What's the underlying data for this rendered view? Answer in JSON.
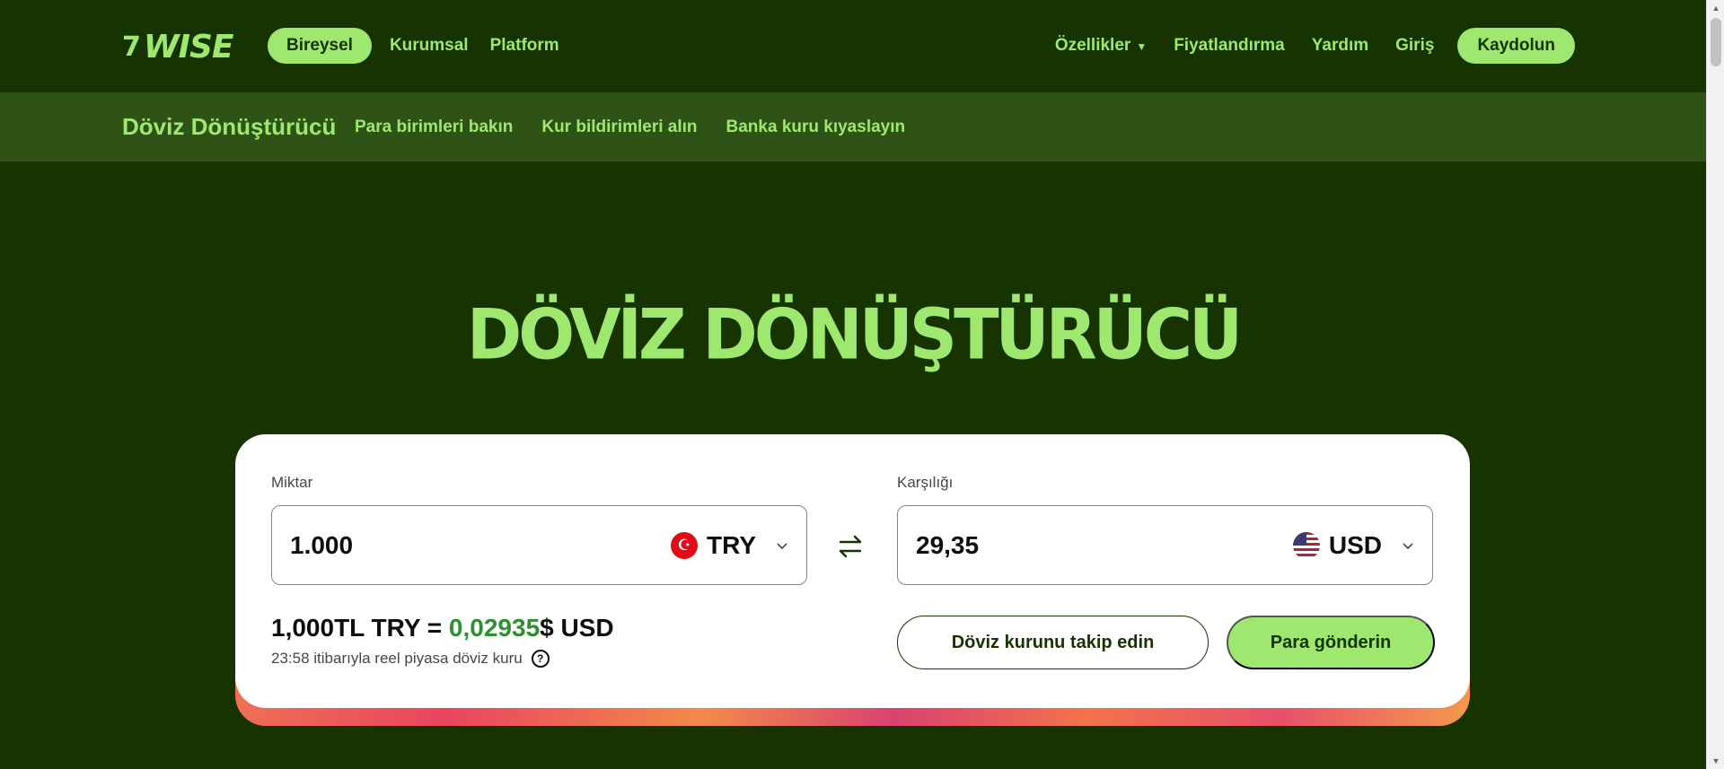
{
  "brand": {
    "logo_text": "WISE",
    "logo_mark": "7"
  },
  "topnav": {
    "left": [
      "Bireysel",
      "Kurumsal",
      "Platform"
    ],
    "right": [
      "Özellikler",
      "Fiyatlandırma",
      "Yardım",
      "Giriş"
    ],
    "signup": "Kaydolun"
  },
  "subnav": {
    "title": "Döviz Dönüştürücü",
    "links": [
      "Para birimleri bakın",
      "Kur bildirimleri alın",
      "Banka kuru kıyaslayın"
    ]
  },
  "hero": {
    "title": "DÖVİZ DÖNÜŞTÜRÜCÜ"
  },
  "converter": {
    "from": {
      "label": "Miktar",
      "value": "1.000",
      "currency": "TRY",
      "flag": "turkey-flag-icon"
    },
    "to": {
      "label": "Karşılığı",
      "value": "29,35",
      "currency": "USD",
      "flag": "usa-flag-icon"
    },
    "rate": {
      "prefix": "1,000TL TRY = ",
      "value": "0,02935",
      "suffix": "$ USD"
    },
    "rate_note": "23:58 itibarıyla reel piyasa döviz kuru",
    "track_button": "Döviz kurunu takip edin",
    "send_button": "Para gönderin"
  },
  "colors": {
    "background": "#163300",
    "accent": "#9fe870",
    "subnav_bg": "#2f5317",
    "rate_green": "#2f8f32"
  }
}
